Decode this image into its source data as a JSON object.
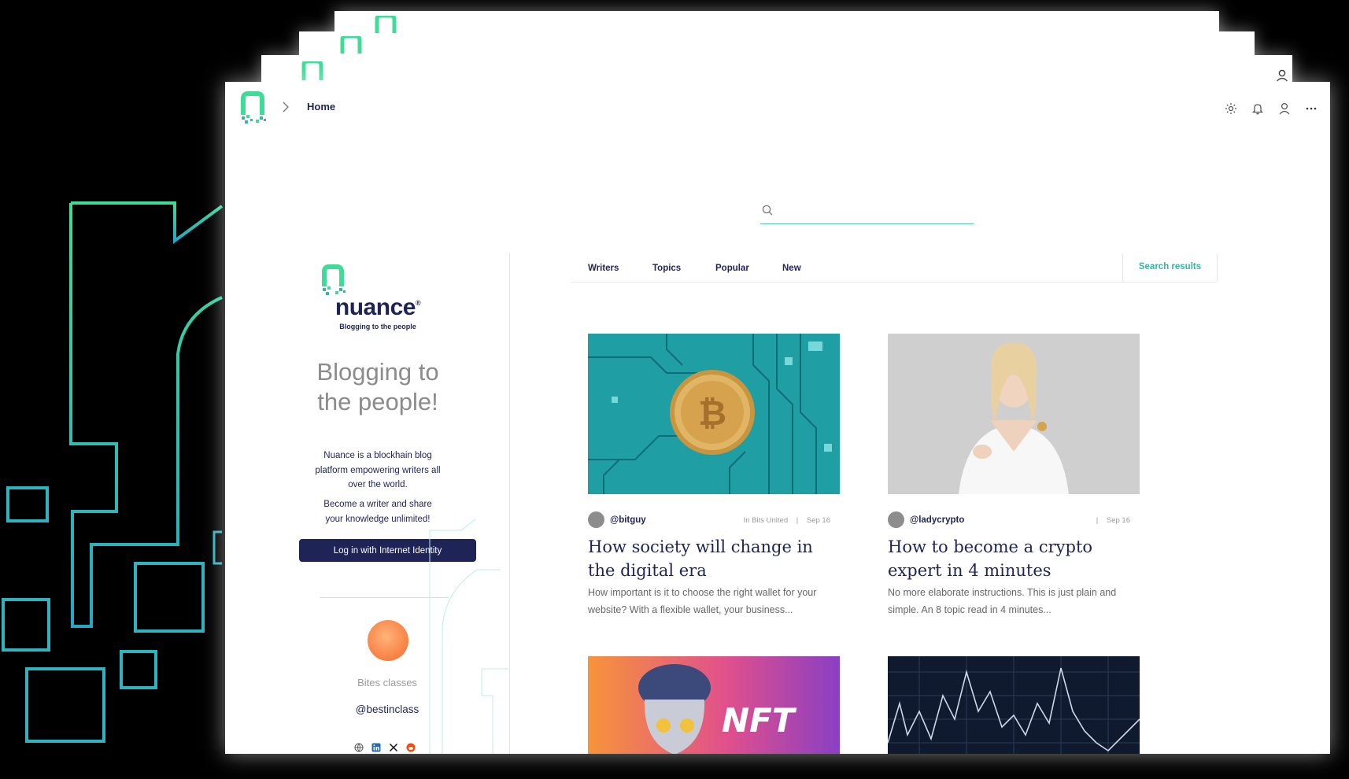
{
  "header": {
    "breadcrumb_title": "Home",
    "icons": [
      "gear-icon",
      "bell-icon",
      "user-icon",
      "more-icon"
    ]
  },
  "search": {
    "placeholder": "",
    "value": ""
  },
  "sidebar": {
    "logo_name": "nuance",
    "logo_tagline": "Blogging to the people",
    "headline": "Blogging to the people!",
    "description": "Nuance is a blockhain blog platform empowering writers all over the world.",
    "cta_text": "Become a writer and share your knowledge unlimited!",
    "login_button": "Log in with Internet Identity",
    "publication": {
      "name": "Bites classes",
      "handle": "@bestinclass",
      "socials": [
        "globe-icon",
        "linkedin-icon",
        "x-icon",
        "reddit-icon"
      ]
    }
  },
  "tabs": {
    "items": [
      {
        "label": "Writers"
      },
      {
        "label": "Topics"
      },
      {
        "label": "Popular"
      },
      {
        "label": "New"
      }
    ],
    "search_results": "Search results"
  },
  "articles": [
    {
      "author": "@bitguy",
      "publication": "In Bits United",
      "separator": "|",
      "date": "Sep 16",
      "title": "How society will change in the digital era",
      "excerpt": "How important is it to choose the right wallet for your website? With a flexible wallet, your business...",
      "image": "bitcoin-circuit-image"
    },
    {
      "author": "@ladycrypto",
      "publication": "",
      "separator": "|",
      "date": "Sep 16",
      "title": "How to become a crypto expert in 4 minutes",
      "excerpt": "No more elaborate instructions. This is just plain and simple. An 8 topic read in 4 minutes...",
      "image": "woman-holding-coin-image"
    },
    {
      "image": "nft-statue-image",
      "image_text": "NFT"
    },
    {
      "image": "stock-chart-image"
    }
  ],
  "colors": {
    "brand_navy": "#1e2456",
    "accent_teal": "#35b5a2",
    "accent_green": "#3ddc97"
  }
}
